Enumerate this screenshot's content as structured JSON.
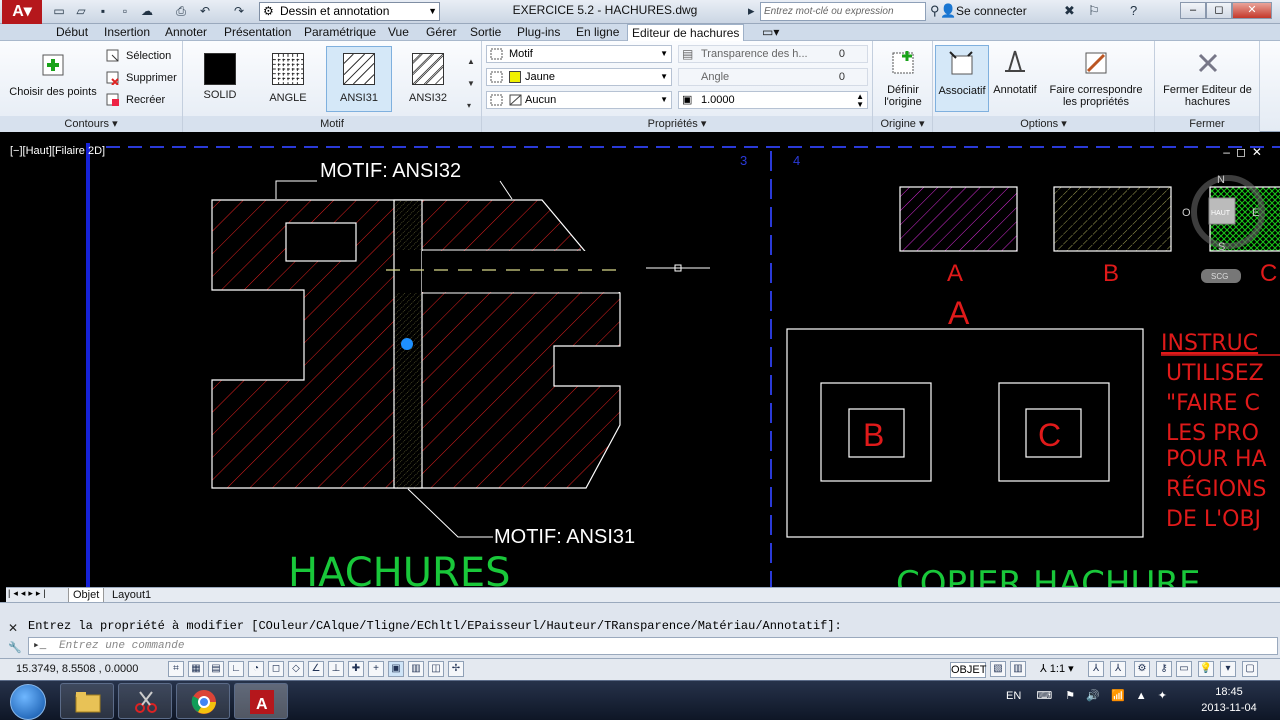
{
  "titlebar": {
    "workspace": "Dessin et annotation",
    "title": "EXERCICE 5.2 - HACHURES.dwg",
    "search_placeholder": "Entrez mot-clé ou expression",
    "signin": "Se connecter"
  },
  "tabs": [
    {
      "label": "Début"
    },
    {
      "label": "Insertion"
    },
    {
      "label": "Annoter"
    },
    {
      "label": "Présentation"
    },
    {
      "label": "Paramétrique"
    },
    {
      "label": "Vue"
    },
    {
      "label": "Gérer"
    },
    {
      "label": "Sortie"
    },
    {
      "label": "Plug-ins"
    },
    {
      "label": "En ligne"
    },
    {
      "label": "Editeur de hachures"
    }
  ],
  "ribbon": {
    "contours": {
      "title": "Contours",
      "pick_points": "Choisir des points",
      "select": "Sélection",
      "remove": "Supprimer",
      "recreate": "Recréer"
    },
    "motif": {
      "title": "Motif",
      "patterns": [
        "SOLID",
        "ANGLE",
        "ANSI31",
        "ANSI32"
      ]
    },
    "proprietes": {
      "title": "Propriétés",
      "type": "Motif",
      "color": "Jaune",
      "background": "Aucun",
      "transparency_label": "Transparence des h...",
      "transparency_value": "0",
      "angle_label": "Angle",
      "angle_value": "0",
      "scale_value": "1.0000"
    },
    "origine": {
      "title": "Origine",
      "set_origin": "Définir l'origine"
    },
    "options": {
      "title": "Options",
      "associative": "Associatif",
      "annotative": "Annotatif",
      "match": "Faire correspondre les propriétés"
    },
    "fermer": {
      "title": "Fermer",
      "close": "Fermer Editeur de hachures"
    }
  },
  "viewport": {
    "label": "[−][Haut][Filaire 2D]",
    "annotations": {
      "motif_top": "MOTIF: ANSI32",
      "motif_bottom": "MOTIF: ANSI31",
      "hachures": "HACHURES",
      "copier": "COPIER HACHURE",
      "label_a_small": "A",
      "label_b_small": "B",
      "label_a_big": "A",
      "label_b_box": "B",
      "label_c_box": "C",
      "viewport_num_3": "3",
      "viewport_num_4": "4"
    },
    "instructions": [
      "INSTRUC",
      "UTILISEZ",
      "\"FAIRE C",
      "LES PRO",
      "POUR HA",
      "RÉGIONS",
      "DE L'OBJ"
    ],
    "viewcube": {
      "n": "N",
      "s": "S",
      "e": "E",
      "o": "O",
      "face": "HAUT",
      "wcs": "SCG"
    }
  },
  "layout_tabs": [
    "Objet",
    "Layout1"
  ],
  "command": {
    "prompt": "Entrez la propriété à modifier [COuleur/CAlque/Tligne/EChltl/EPaisseurl/Hauteur/TRansparence/Matériau/Annotatif]:",
    "placeholder": "Entrez une commande"
  },
  "status": {
    "coords": "15.3749, 8.5508 , 0.0000",
    "objet": "OBJET",
    "scale": "1:1"
  },
  "taskbar": {
    "lang": "EN",
    "time": "18:45",
    "date": "2013-11-04"
  },
  "colors": {
    "hatch_red": "#e0201f",
    "hatch_yellow": "#c8c86a",
    "hatch_magenta": "#d22ad2",
    "hatch_green": "#19c819",
    "annot_green": "#19c83a",
    "instr_red": "#e01a1a",
    "viewport_blue": "#1622d8"
  }
}
